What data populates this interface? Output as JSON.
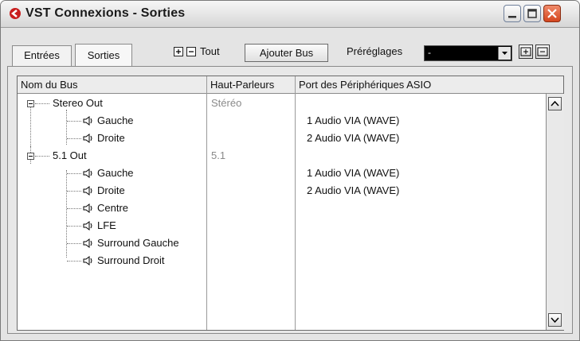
{
  "window": {
    "title": "VST Connexions - Sorties"
  },
  "tabs": [
    {
      "label": "Entrées",
      "active": false
    },
    {
      "label": "Sorties",
      "active": true
    }
  ],
  "toolbar": {
    "tout_label": "Tout",
    "add_bus_label": "Ajouter Bus",
    "presets_label": "Préréglages",
    "preset_value": "-"
  },
  "table": {
    "columns": [
      "Nom du Bus",
      "Haut-Parleurs",
      "Port des Périphériques ASIO"
    ],
    "rows": [
      {
        "name": "Stereo Out",
        "speakers": "Stéréo",
        "port": "",
        "level": 0
      },
      {
        "name": "Gauche",
        "speakers": "",
        "port": "1 Audio VIA (WAVE)",
        "level": 1
      },
      {
        "name": "Droite",
        "speakers": "",
        "port": "2 Audio VIA (WAVE)",
        "level": 1
      },
      {
        "name": "5.1 Out",
        "speakers": "5.1",
        "port": "",
        "level": 0
      },
      {
        "name": "Gauche",
        "speakers": "",
        "port": "1 Audio VIA (WAVE)",
        "level": 1
      },
      {
        "name": "Droite",
        "speakers": "",
        "port": "2 Audio VIA (WAVE)",
        "level": 1
      },
      {
        "name": "Centre",
        "speakers": "",
        "port": "",
        "level": 1
      },
      {
        "name": "LFE",
        "speakers": "",
        "port": "",
        "level": 1
      },
      {
        "name": "Surround Gauche",
        "speakers": "",
        "port": "",
        "level": 1
      },
      {
        "name": "Surround Droit",
        "speakers": "",
        "port": "",
        "level": 1
      }
    ]
  },
  "colors": {
    "close_button": "#d4461e",
    "logo_red": "#c81e1e"
  }
}
